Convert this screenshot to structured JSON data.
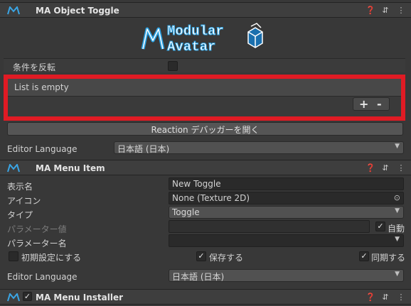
{
  "object_toggle": {
    "title": "MA Object Toggle",
    "logo_line1": "Modular",
    "logo_line2": "Avatar",
    "invert_label": "条件を反転",
    "list_empty": "List is empty",
    "add_label": "+",
    "remove_label": "-",
    "reaction_debugger": "Reaction デバッガーを開く",
    "editor_language_label": "Editor Language",
    "editor_language_value": "日本語 (日本)"
  },
  "menu_item": {
    "title": "MA Menu Item",
    "display_name_label": "表示名",
    "display_name_value": "New Toggle",
    "icon_label": "アイコン",
    "icon_value": "None (Texture 2D)",
    "type_label": "タイプ",
    "type_value": "Toggle",
    "param_value_label": "パラメーター値",
    "auto_label": "自動",
    "param_name_label": "パラメーター名",
    "default_on_label": "初期設定にする",
    "saved_label": "保存する",
    "synced_label": "同期する",
    "editor_language_label": "Editor Language",
    "editor_language_value": "日本語 (日本)"
  },
  "menu_installer": {
    "title": "MA Menu Installer"
  },
  "colors": {
    "highlight": "#e01b24",
    "logo_blue": "#2a9fe0"
  },
  "icons": [
    "ma-component-icon",
    "help-icon",
    "presets-icon",
    "more-icon",
    "object-picker-icon",
    "dropdown-arrow-icon"
  ]
}
